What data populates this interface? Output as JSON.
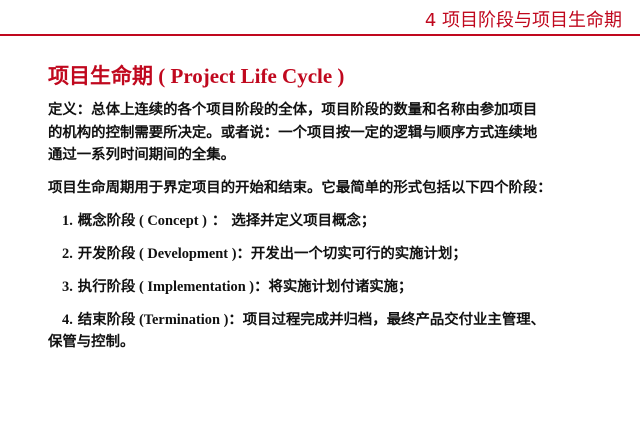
{
  "header": {
    "section": "4  项目阶段与项目生命期"
  },
  "title": {
    "cn": "项目生命期",
    "en": " ( Project Life Cycle )"
  },
  "definition": {
    "lines": [
      "定义：总体上连续的各个项目阶段的全体，项目阶段的数量和名称由参加项目",
      "的机构的控制需要所决定。或者说：一个项目按一定的逻辑与顺序方式连续地",
      "通过一系列时间期间的全集。"
    ]
  },
  "intro": "项目生命周期用于界定项目的开始和结束。它最简单的形式包括以下四个阶段：",
  "stages": [
    {
      "num": "1.",
      "name": " 概念阶段",
      "en": " ( Concept )",
      "desc": " ：  选择并定义项目概念；"
    },
    {
      "num": "2.",
      "name": " 开发阶段",
      "en": " ( Development )",
      "desc": "：开发出一个切实可行的实施计划；"
    },
    {
      "num": "3.",
      "name": " 执行阶段",
      "en": " ( Implementation )",
      "desc": "：将实施计划付诸实施；"
    },
    {
      "num": "4.",
      "name": " 结束阶段",
      "en": " (Termination )",
      "desc": "：项目过程完成并归档，最终产品交付业主管理、",
      "desc2": "保管与控制。"
    }
  ],
  "colors": {
    "accent": "#c0081e",
    "text": "#111111"
  }
}
